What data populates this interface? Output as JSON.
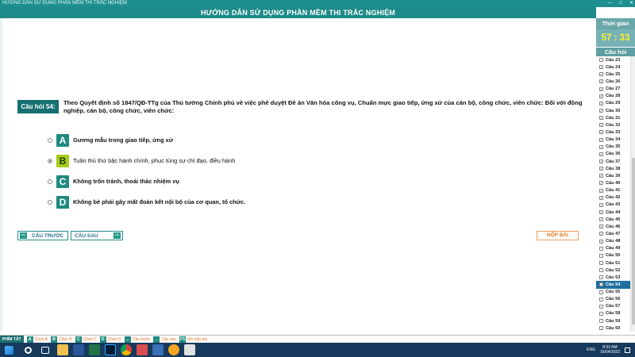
{
  "window": {
    "title": "HƯỚNG DẪN SỬ DỤNG PHẦN MỀM THI TRẮC NGHIỆM",
    "banner": "HƯỚNG DẪN SỬ DỤNG PHẦN MỀM THI TRẮC NGHIỆM"
  },
  "question": {
    "label": "Câu hỏi 54:",
    "text": "Theo Quyết định số 1847/QĐ-TTg của Thủ tướng Chính phủ về việc phê duyệt Đề án Văn hóa công vụ, Chuẩn mực giao tiếp, ứng xử của cán bộ, công chức, viên chức: Đối với đồng nghiệp, cán bộ, công chức, viên chức:",
    "answers": [
      {
        "letter": "A",
        "text": "Gương mẫu trong giao tiếp, ứng xử"
      },
      {
        "letter": "B",
        "text": "Tuân thủ thứ bậc hành chính, phục tùng sự chỉ đạo, điều hành"
      },
      {
        "letter": "C",
        "text": "Không trốn tránh, thoái thác nhiệm vụ"
      },
      {
        "letter": "D",
        "text": "Không bè phái gây mất đoàn kết nội bộ của cơ quan, tổ chức."
      }
    ],
    "selected": "B"
  },
  "nav": {
    "prev_label": "CÂU TRƯỚC",
    "next_label": "CÂU SAU",
    "submit_label": "NỘP BÀI"
  },
  "sidebar": {
    "time_label": "Thời gian",
    "timer": "57 : 33",
    "questions_label": "Câu hỏi",
    "items": [
      {
        "label": "Câu 23",
        "checked": false
      },
      {
        "label": "Câu 24",
        "checked": true
      },
      {
        "label": "Câu 25",
        "checked": true
      },
      {
        "label": "Câu 26",
        "checked": true
      },
      {
        "label": "Câu 27",
        "checked": true
      },
      {
        "label": "Câu 28",
        "checked": true
      },
      {
        "label": "Câu 29",
        "checked": true
      },
      {
        "label": "Câu 30",
        "checked": true
      },
      {
        "label": "Câu 31",
        "checked": true
      },
      {
        "label": "Câu 32",
        "checked": true
      },
      {
        "label": "Câu 33",
        "checked": true
      },
      {
        "label": "Câu 34",
        "checked": true
      },
      {
        "label": "Câu 35",
        "checked": true
      },
      {
        "label": "Câu 36",
        "checked": true
      },
      {
        "label": "Câu 37",
        "checked": true
      },
      {
        "label": "Câu 38",
        "checked": true
      },
      {
        "label": "Câu 39",
        "checked": true
      },
      {
        "label": "Câu 40",
        "checked": true
      },
      {
        "label": "Câu 41",
        "checked": true
      },
      {
        "label": "Câu 42",
        "checked": true
      },
      {
        "label": "Câu 43",
        "checked": true
      },
      {
        "label": "Câu 44",
        "checked": true
      },
      {
        "label": "Câu 45",
        "checked": true
      },
      {
        "label": "Câu 46",
        "checked": true
      },
      {
        "label": "Câu 47",
        "checked": true
      },
      {
        "label": "Câu 48",
        "checked": true
      },
      {
        "label": "Câu 49",
        "checked": false
      },
      {
        "label": "Câu 50",
        "checked": false
      },
      {
        "label": "Câu 51",
        "checked": false
      },
      {
        "label": "Câu 52",
        "checked": false
      },
      {
        "label": "Câu 53",
        "checked": false
      },
      {
        "label": "Câu 54",
        "checked": true,
        "active": true
      },
      {
        "label": "Câu 55",
        "checked": false
      },
      {
        "label": "Câu 56",
        "checked": false
      },
      {
        "label": "Câu 57",
        "checked": false
      },
      {
        "label": "Câu 58",
        "checked": false
      },
      {
        "label": "Câu 59",
        "checked": false
      },
      {
        "label": "Câu 60",
        "checked": false
      }
    ]
  },
  "hotkeys": {
    "label": "PHÍM TẮT",
    "items": [
      {
        "key": "A",
        "text": "Chọn A"
      },
      {
        "key": "B",
        "text": "Chọn B"
      },
      {
        "key": "C",
        "text": "Chọn C"
      },
      {
        "key": "D",
        "text": "Chọn D"
      },
      {
        "key": "←",
        "text": "Câu trước"
      },
      {
        "key": "→",
        "text": "Câu sau"
      },
      {
        "key": "F5",
        "text": "Xin nộp bài"
      }
    ]
  },
  "taskbar": {
    "time": "8:53 AM",
    "date": "16/04/2022",
    "lang": "ENG"
  },
  "colors": {
    "teal": "#1e8a8a",
    "timer": "#ffef2e",
    "selected_letter": "#a6cc1c",
    "submit": "#e07a20"
  }
}
